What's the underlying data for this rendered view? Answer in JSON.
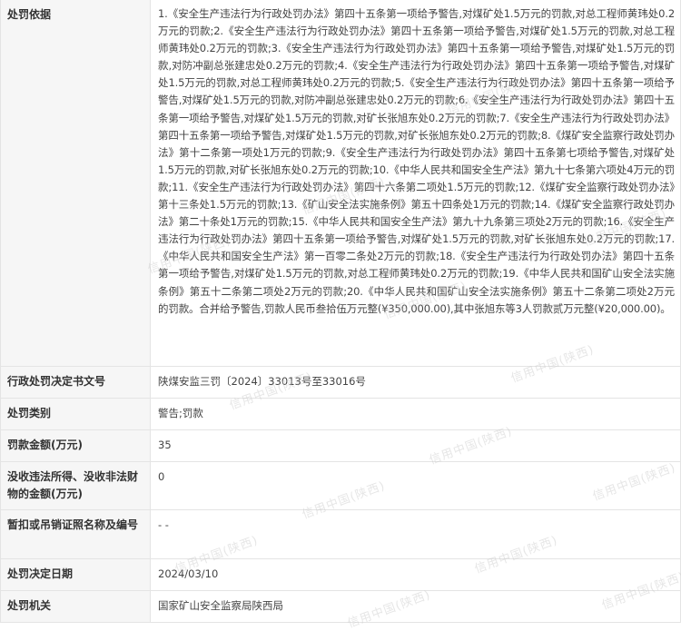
{
  "rows": [
    {
      "label": "处罚依据",
      "value": "1.《安全生产违法行为行政处罚办法》第四十五条第一项给予警告,对煤矿处1.5万元的罚款,对总工程师黄玮处0.2万元的罚款;2.《安全生产违法行为行政处罚办法》第四十五条第一项给予警告,对煤矿处1.5万元的罚款,对总工程师黄玮处0.2万元的罚款;3.《安全生产违法行为行政处罚办法》第四十五条第一项给予警告,对煤矿处1.5万元的罚款,对防冲副总张建忠处0.2万元的罚款;4.《安全生产违法行为行政处罚办法》第四十五条第一项给予警告,对煤矿处1.5万元的罚款,对总工程师黄玮处0.2万元的罚款;5.《安全生产违法行为行政处罚办法》第四十五条第一项给予警告,对煤矿处1.5万元的罚款,对防冲副总张建忠处0.2万元的罚款;6.《安全生产违法行为行政处罚办法》第四十五条第一项给予警告,对煤矿处1.5万元的罚款,对矿长张旭东处0.2万元的罚款;7.《安全生产违法行为行政处罚办法》第四十五条第一项给予警告,对煤矿处1.5万元的罚款,对矿长张旭东处0.2万元的罚款;8.《煤矿安全监察行政处罚办法》第十二条第一项处1万元的罚款;9.《安全生产违法行为行政处罚办法》第四十五条第七项给予警告,对煤矿处1.5万元的罚款,对矿长张旭东处0.2万元的罚款;10.《中华人民共和国安全生产法》第九十七条第六项处4万元的罚款;11.《安全生产违法行为行政处罚办法》第四十六条第二项处1.5万元的罚款;12.《煤矿安全监察行政处罚办法》第十三条处1.5万元的罚款;13.《矿山安全法实施条例》第五十四条处1万元的罚款;14.《煤矿安全监察行政处罚办法》第二十条处1万元的罚款;15.《中华人民共和国安全生产法》第九十九条第三项处2万元的罚款;16.《安全生产违法行为行政处罚办法》第四十五条第一项给予警告,对煤矿处1.5万元的罚款,对矿长张旭东处0.2万元的罚款;17.《中华人民共和国安全生产法》第一百零二条处2万元的罚款;18.《安全生产违法行为行政处罚办法》第四十五条第一项给予警告,对煤矿处1.5万元的罚款,对总工程师黄玮处0.2万元的罚款;19.《中华人民共和国矿山安全法实施条例》第五十二条第二项处2万元的罚款;20.《中华人民共和国矿山安全法实施条例》第五十二条第二项处2万元的罚款。合并给予警告,罚款人民币叁拾伍万元整(¥350,000.00),其中张旭东等3人罚款贰万元整(¥20,000.00)。"
    },
    {
      "label": "行政处罚决定书文号",
      "value": "陕煤安监三罚〔2024〕33013号至33016号"
    },
    {
      "label": "处罚类别",
      "value": "警告;罚款"
    },
    {
      "label": "罚款金额(万元)",
      "value": "35"
    },
    {
      "label": "没收违法所得、没收非法财物的金额(万元)",
      "value": "0"
    },
    {
      "label": "暂扣或吊销证照名称及编号",
      "value": "- -"
    },
    {
      "label": "处罚决定日期",
      "value": "2024/03/10"
    },
    {
      "label": "处罚机关",
      "value": "国家矿山安全监察局陕西局"
    }
  ],
  "watermark_text": "信用中国(陕西)"
}
